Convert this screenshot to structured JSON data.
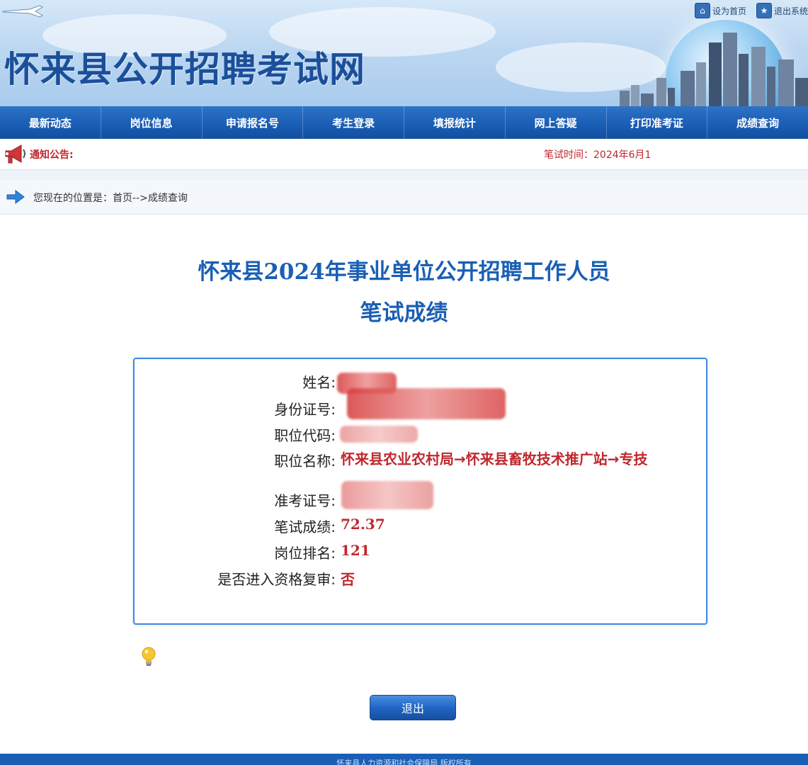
{
  "header": {
    "site_title": "怀来县公开招聘考试网",
    "set_home_label": "设为首页",
    "logout_label": "退出系统"
  },
  "nav": {
    "items": [
      "最新动态",
      "岗位信息",
      "申请报名号",
      "考生登录",
      "填报统计",
      "网上答疑",
      "打印准考证",
      "成绩查询"
    ]
  },
  "notice": {
    "label": "通知公告:",
    "text": "笔试时间：2024年6月1"
  },
  "breadcrumb": {
    "prefix": "您现在的位置是：",
    "home": "首页",
    "separator": "-->",
    "current": "成绩查询"
  },
  "result": {
    "title": "怀来县2024年事业单位公开招聘工作人员",
    "subtitle": "笔试成绩",
    "fields": {
      "name": {
        "label": "姓名:",
        "value": ""
      },
      "id_number": {
        "label": "身份证号:",
        "value": ""
      },
      "position_code": {
        "label": "职位代码:",
        "value": ""
      },
      "position_name": {
        "label": "职位名称:",
        "value": "怀来县农业农村局→怀来县畜牧技术推广站→专技"
      },
      "admission_number": {
        "label": "准考证号:",
        "value": ""
      },
      "written_score": {
        "label": "笔试成绩:",
        "value": "72.37"
      },
      "position_rank": {
        "label": "岗位排名:",
        "value": "121"
      },
      "qualified_review": {
        "label": "是否进入资格复审:",
        "value": "否"
      }
    }
  },
  "actions": {
    "exit_label": "退出"
  },
  "footer": {
    "text": "怀来县人力资源和社会保障局 版权所有"
  }
}
